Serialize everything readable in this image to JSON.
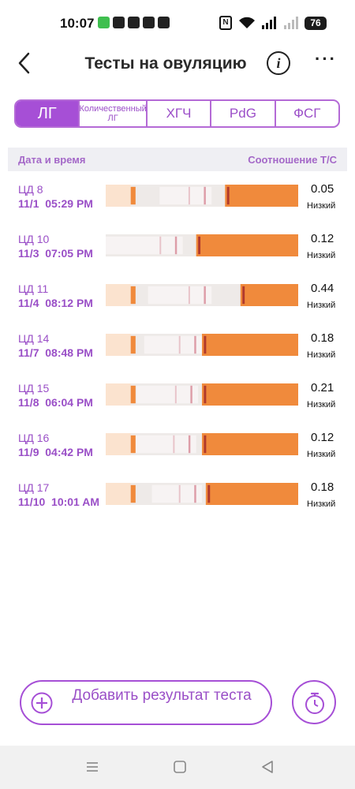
{
  "status_bar": {
    "time": "10:07",
    "battery": "76"
  },
  "header": {
    "title": "Тесты на овуляцию",
    "info_label": "i",
    "more_label": "···"
  },
  "tabs": [
    {
      "label": "ЛГ",
      "active": true
    },
    {
      "label": "Количественный ЛГ",
      "active": false
    },
    {
      "label": "ХГЧ",
      "active": false
    },
    {
      "label": "PdG",
      "active": false
    },
    {
      "label": "ФСГ",
      "active": false
    }
  ],
  "table": {
    "col_date": "Дата и время",
    "col_ratio": "Соотношение Т/С"
  },
  "rows": [
    {
      "cycle": "ЦД 8",
      "date": "11/1  05:29 PM",
      "ratio": "0.05",
      "level": "Низкий"
    },
    {
      "cycle": "ЦД 10",
      "date": "11/3  07:05 PM",
      "ratio": "0.12",
      "level": "Низкий"
    },
    {
      "cycle": "ЦД 11",
      "date": "11/4  08:12 PM",
      "ratio": "0.44",
      "level": "Низкий"
    },
    {
      "cycle": "ЦД 14",
      "date": "11/7  08:48 PM",
      "ratio": "0.18",
      "level": "Низкий"
    },
    {
      "cycle": "ЦД 15",
      "date": "11/8  06:04 PM",
      "ratio": "0.21",
      "level": "Низкий"
    },
    {
      "cycle": "ЦД 16",
      "date": "11/9  04:42 PM",
      "ratio": "0.12",
      "level": "Низкий"
    },
    {
      "cycle": "ЦД 17",
      "date": "11/10  10:01 AM",
      "ratio": "0.18",
      "level": "Низкий"
    }
  ],
  "actions": {
    "add_result": "Добавить результат теста"
  },
  "colors": {
    "accent": "#a64fd6",
    "strip_orange": "#f08a3c",
    "test_line": "#c8556a"
  },
  "icons": [
    "back-arrow-icon",
    "info-icon",
    "more-icon",
    "plus-icon",
    "timer-icon",
    "menu-icon",
    "home-icon",
    "back-triangle-icon"
  ]
}
